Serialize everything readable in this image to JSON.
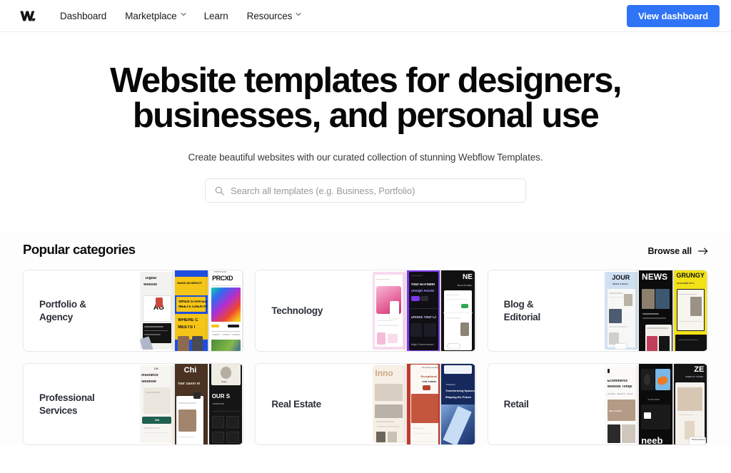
{
  "navbar": {
    "logo_name": "webflow-logo",
    "links": [
      {
        "label": "Dashboard",
        "has_chevron": false
      },
      {
        "label": "Marketplace",
        "has_chevron": true
      },
      {
        "label": "Learn",
        "has_chevron": false
      },
      {
        "label": "Resources",
        "has_chevron": true
      }
    ],
    "cta_label": "View dashboard",
    "cta_color": "#2f73f7"
  },
  "hero": {
    "title_line1": "Website templates for designers,",
    "title_line2": "businesses, and personal use",
    "subtitle": "Create beautiful websites with our curated collection of stunning Webflow Templates.",
    "search": {
      "placeholder": "Search all templates (e.g. Business, Portfolio)",
      "value": ""
    }
  },
  "categories": {
    "heading": "Popular categories",
    "browse_all_label": "Browse all",
    "cards": [
      {
        "label_line1": "Portfolio &",
        "label_line2": "Agency",
        "thumb_texts": [
          "Digital Website",
          "AG",
          "WHEN STRATEGY MEETS CREATIVE",
          "WHERE C MEETS",
          "PRCXD"
        ]
      },
      {
        "label_line1": "Technology",
        "label_line2": "",
        "thumb_texts": [
          "Your AI-Powered Design Assistant",
          "Unlock Your Cr",
          "NE"
        ]
      },
      {
        "label_line1": "Blog &",
        "label_line2": "Editorial",
        "thumb_texts": [
          "JOUR",
          "NEWS",
          "GRUNGY"
        ]
      },
      {
        "label_line1": "Professional",
        "label_line2": "Services",
        "thumb_texts": [
          "Insurance Webflow",
          "Chic",
          "Hair Salon We",
          "OUR S"
        ]
      },
      {
        "label_line1": "Real Estate",
        "label_line2": "",
        "thumb_texts": [
          "Inno",
          "Transforming Spaces, Shaping the Future"
        ]
      },
      {
        "label_line1": "Retail",
        "label_line2": "",
        "thumb_texts": [
          "Ecommerce Website Templ",
          "neeb",
          "ZE"
        ]
      }
    ]
  }
}
